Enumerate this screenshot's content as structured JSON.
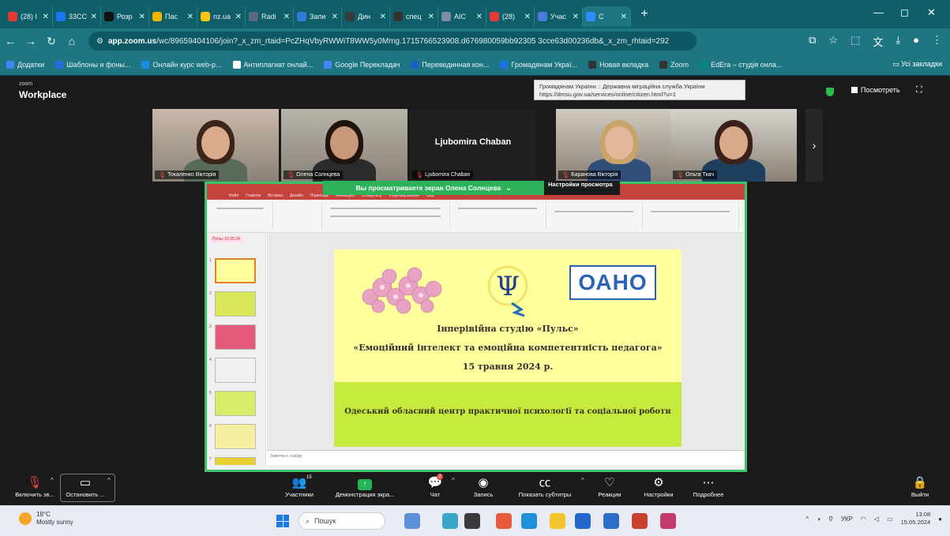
{
  "browser": {
    "tabs": [
      {
        "label": "(28) I",
        "color": "#e53935"
      },
      {
        "label": "33CC",
        "color": "#1877f2"
      },
      {
        "label": "Розр",
        "color": "#111111"
      },
      {
        "label": "Пас",
        "color": "#f4b400"
      },
      {
        "label": "nz.ua",
        "color": "#f9c510"
      },
      {
        "label": "Radi",
        "color": "#5b6b7f"
      },
      {
        "label": "Запи",
        "color": "#2f7bd8"
      },
      {
        "label": "Дин",
        "color": "#3a3a3a"
      },
      {
        "label": "спец",
        "color": "#333333"
      },
      {
        "label": "AIC",
        "color": "#7c8da6"
      },
      {
        "label": "(28)",
        "color": "#e53935"
      },
      {
        "label": "Учас",
        "color": "#4c7bd9"
      },
      {
        "label": "C",
        "color": "#2d8cff"
      }
    ],
    "url_host": "app.zoom.us",
    "url_rest": "/wc/89659404106/join?_x_zm_rtaid=PcZHqVbyRWWiT8WW5y0Mmg.1715766523908.d676980059bb92305 3cce63d00236db&_x_zm_rhtaid=292",
    "bookmarks": [
      {
        "label": "Додатки",
        "color": "#4285f4"
      },
      {
        "label": "Шаблоны и фоны...",
        "color": "#2a6be0"
      },
      {
        "label": "Онлайн курс web-р...",
        "color": "#1e88e5"
      },
      {
        "label": "Антиплагиат онлай...",
        "color": "#ffffff"
      },
      {
        "label": "Google Перекладач",
        "color": "#4285f4"
      },
      {
        "label": "Перевединная кон...",
        "color": "#1565c0"
      },
      {
        "label": "Громадянам Украї...",
        "color": "#1a73e8"
      },
      {
        "label": "Новая вкладка",
        "color": "#333333"
      },
      {
        "label": "Zoom",
        "color": "#333333"
      },
      {
        "label": "EdEra – студія онла...",
        "color": "#00897b"
      }
    ],
    "bookmarks_right": "Усі закладки"
  },
  "tooltip": {
    "line1": "Громадянам України :: Державна міграційна служба України",
    "line2": "https://dmsu.gov.ua/services/online/citizen.html?u=1"
  },
  "zoom": {
    "logo_small": "zoom",
    "logo": "Workplace",
    "view_label": "Посмотреть"
  },
  "participants": [
    {
      "name": "Токаленко Вікторія",
      "bg": "#c9b8a8",
      "hair": "#3b2418",
      "skin": "#d9ab8c",
      "shirt": "#5a6a5a"
    },
    {
      "name": "Олена Солнцева",
      "bg": "#b8b4aa",
      "hair": "#1f1410",
      "skin": "#c9977a",
      "shirt": "#2b2b2b"
    },
    {
      "name": "Ljubomira Chaban",
      "bg": "#1f1f1f",
      "hair": "",
      "skin": "",
      "shirt": ""
    },
    {
      "name": "Баранова Вікторія",
      "bg": "#cfc9c0",
      "hair": "#c9a46a",
      "skin": "#e3b79a",
      "shirt": "#2f4f7a"
    },
    {
      "name": "Ольга Ткач",
      "bg": "#d6d3cc",
      "hair": "#3a2018",
      "skin": "#d9a98b",
      "shirt": "#1f3f5f"
    }
  ],
  "share": {
    "banner": "Вы просматриваете экран Олена Солнцева",
    "view_settings": "Настройки просмотра"
  },
  "ppt": {
    "tabs": [
      "Файл",
      "Главная",
      "Вставка",
      "Дизайн",
      "Переходы",
      "Анимация",
      "Слайд-шоу",
      "Рецензирование",
      "Вид"
    ],
    "section_label": "Пульс 15.05.24",
    "notes_placeholder": "Заметки к слайду",
    "thumb_numbers": [
      "1",
      "2",
      "3",
      "4",
      "5",
      "6",
      "7"
    ]
  },
  "slide": {
    "logo_text": "ОАНО",
    "line1": "Інперівійна студію «Пульс»",
    "line2": "«Емоційний інтелект та емоційна компетентність педагога»",
    "line3": "15 травня 2024 р.",
    "line4": "Одеський обласний центр практичної психології та соціальної роботи",
    "colors": {
      "upper": "#ffff9e",
      "lower": "#c6ea3e",
      "text": "#3d2c2c"
    }
  },
  "toolbar": {
    "mic_label": "Включить зв...",
    "video_label": "Остановить ...",
    "participants_label": "Участники",
    "participants_count": "15",
    "share_label": "Демонстрация экра...",
    "chat_label": "Чат",
    "chat_badge": "2",
    "record_label": "Запись",
    "cc_label": "Показать субтитры",
    "reactions_label": "Реакции",
    "settings_label": "Настройки",
    "more_label": "Подробнее",
    "leave_label": "Выйти"
  },
  "taskbar": {
    "temp": "18°C",
    "weather": "Mostly sunny",
    "search_placeholder": "Пошук",
    "lang": "УКР",
    "time": "13:08",
    "date": "15.05.2024"
  }
}
